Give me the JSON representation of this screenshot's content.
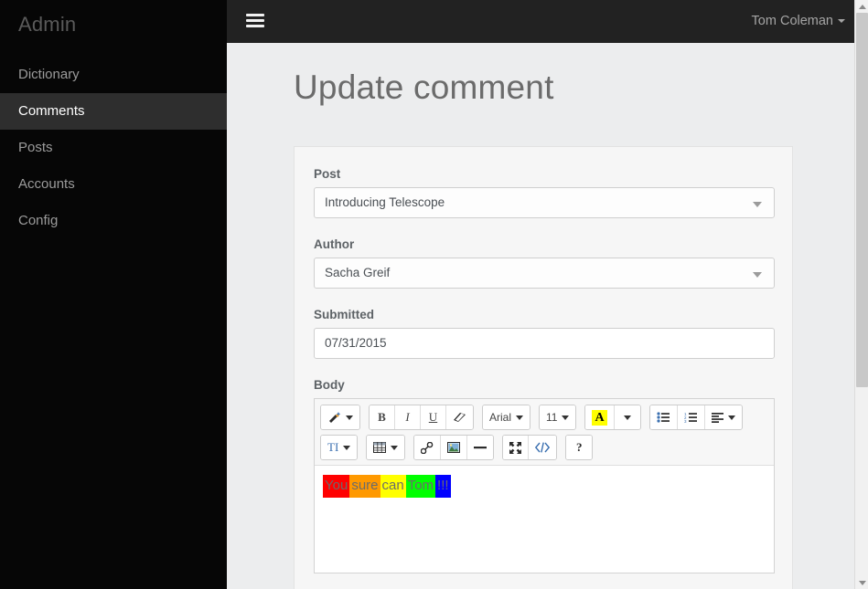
{
  "sidebar": {
    "brand": "Admin",
    "items": [
      {
        "label": "Dictionary",
        "active": false
      },
      {
        "label": "Comments",
        "active": true
      },
      {
        "label": "Posts",
        "active": false
      },
      {
        "label": "Accounts",
        "active": false
      },
      {
        "label": "Config",
        "active": false
      }
    ]
  },
  "topbar": {
    "menu_icon": "hamburger-icon",
    "user_name": "Tom Coleman"
  },
  "page": {
    "title": "Update comment"
  },
  "form": {
    "post": {
      "label": "Post",
      "value": "Introducing Telescope",
      "type": "select"
    },
    "author": {
      "label": "Author",
      "value": "Sacha Greif",
      "type": "select"
    },
    "submitted": {
      "label": "Submitted",
      "value": "07/31/2015",
      "type": "text"
    },
    "body": {
      "label": "Body"
    }
  },
  "editor": {
    "toolbar_row1": [
      {
        "group": [
          {
            "name": "style-magic-wand",
            "icon": "magic-wand-icon",
            "caret": true
          }
        ]
      },
      {
        "group": [
          {
            "name": "bold",
            "label": "B",
            "style": "bold"
          },
          {
            "name": "italic",
            "label": "I",
            "style": "italic"
          },
          {
            "name": "underline",
            "label": "U",
            "style": "underline"
          },
          {
            "name": "remove-format",
            "icon": "eraser-icon"
          }
        ]
      },
      {
        "group": [
          {
            "name": "font-name",
            "label": "Arial",
            "caret": true
          }
        ]
      },
      {
        "group": [
          {
            "name": "font-size",
            "label": "11",
            "caret": true
          }
        ]
      },
      {
        "group": [
          {
            "name": "recent-color",
            "icon": "highlight-a-icon"
          },
          {
            "name": "more-color",
            "caret_only": true
          }
        ]
      },
      {
        "group": [
          {
            "name": "unordered-list",
            "icon": "bullet-list-icon"
          },
          {
            "name": "ordered-list",
            "icon": "numbered-list-icon"
          },
          {
            "name": "paragraph-align",
            "icon": "align-left-icon",
            "caret": true
          }
        ]
      }
    ],
    "toolbar_row2": [
      {
        "group": [
          {
            "name": "style-format",
            "label": "TI",
            "caret": true
          }
        ]
      },
      {
        "group": [
          {
            "name": "table",
            "icon": "table-icon",
            "caret": true
          }
        ]
      },
      {
        "group": [
          {
            "name": "link",
            "icon": "link-icon"
          },
          {
            "name": "picture",
            "icon": "image-icon"
          },
          {
            "name": "horizontal-rule",
            "icon": "hr-icon"
          }
        ]
      },
      {
        "group": [
          {
            "name": "fullscreen",
            "icon": "fullscreen-icon"
          },
          {
            "name": "code-view",
            "icon": "code-icon"
          }
        ]
      },
      {
        "group": [
          {
            "name": "help",
            "icon": "question-icon"
          }
        ]
      }
    ],
    "content_segments": [
      {
        "text": "You",
        "background": "#ff0000",
        "color": "#6b6b6b"
      },
      {
        "text": "sure",
        "background": "#ff9900",
        "color": "#6b6b6b"
      },
      {
        "text": "can",
        "background": "#ffff00",
        "color": "#6b6b6b"
      },
      {
        "text": "Tom",
        "background": "#00ff00",
        "color": "#6b6b6b"
      },
      {
        "text": "!!!",
        "background": "#0000ff",
        "color": "#6b6b6b"
      }
    ],
    "content_plain": "You sure can Tom!!!"
  },
  "colors": {
    "sidebar_bg": "#060606",
    "sidebar_active_bg": "#2e2e2e",
    "topbar_bg": "#222222",
    "content_bg": "#ecedee",
    "card_bg": "#f6f6f6",
    "title_text": "#6b6b6b",
    "label_text": "#5d6266"
  }
}
